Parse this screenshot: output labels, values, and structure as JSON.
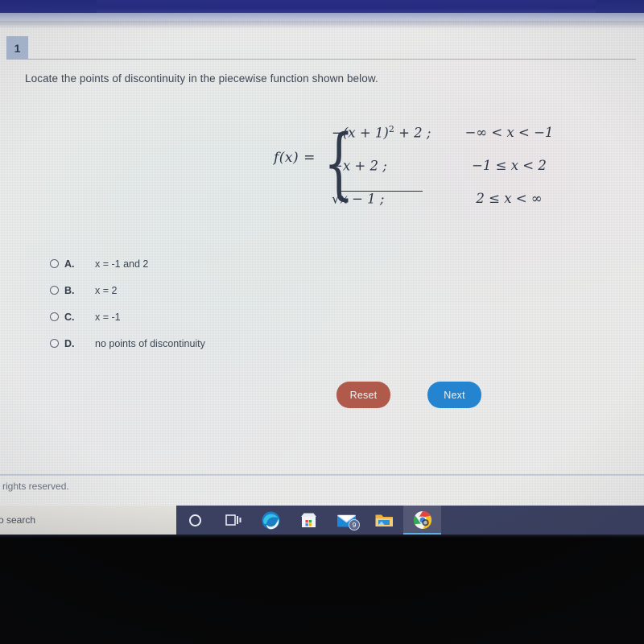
{
  "browser": {
    "top_band_color": "#2a2f86"
  },
  "quiz": {
    "question_number": "1",
    "prompt": "Locate the points of discontinuity in the piecewise function shown below.",
    "function_label": "f(x)",
    "equals": "=",
    "pieces": [
      {
        "expression_prefix": "−(x + 1)",
        "exponent": "2",
        "expression_suffix": " + 2 ;",
        "condition": "−∞ < x < −1"
      },
      {
        "expression_prefix": "−x + 2 ;",
        "exponent": "",
        "expression_suffix": "",
        "condition": "−1 ≤ x < 2"
      },
      {
        "expression_prefix": "√x − 1 ;",
        "exponent": "",
        "expression_suffix": "",
        "condition": "2 ≤ x < ∞"
      }
    ],
    "options": [
      {
        "letter": "A.",
        "text": "x = -1 and 2",
        "selected": false
      },
      {
        "letter": "B.",
        "text": "x = 2",
        "selected": false
      },
      {
        "letter": "C.",
        "text": "x = -1",
        "selected": false
      },
      {
        "letter": "D.",
        "text": "no points of discontinuity",
        "selected": false
      }
    ],
    "buttons": {
      "reset_label": "Reset",
      "reset_color": "#b05a4c",
      "next_label": "Next",
      "next_color": "#2484d0"
    }
  },
  "footer": {
    "copyright_text": "l rights reserved."
  },
  "taskbar": {
    "search_placeholder": "o search",
    "items": [
      {
        "name": "cortana-icon",
        "glyph": "",
        "badge": ""
      },
      {
        "name": "task-view-icon",
        "glyph": "⌸",
        "badge": ""
      },
      {
        "name": "edge-browser-icon",
        "glyph": "",
        "badge": ""
      },
      {
        "name": "microsoft-store-icon",
        "glyph": "",
        "badge": ""
      },
      {
        "name": "mail-icon",
        "glyph": "",
        "badge": "9"
      },
      {
        "name": "file-explorer-icon",
        "glyph": "",
        "badge": ""
      },
      {
        "name": "chrome-browser-icon",
        "glyph": "",
        "badge": ""
      }
    ]
  }
}
